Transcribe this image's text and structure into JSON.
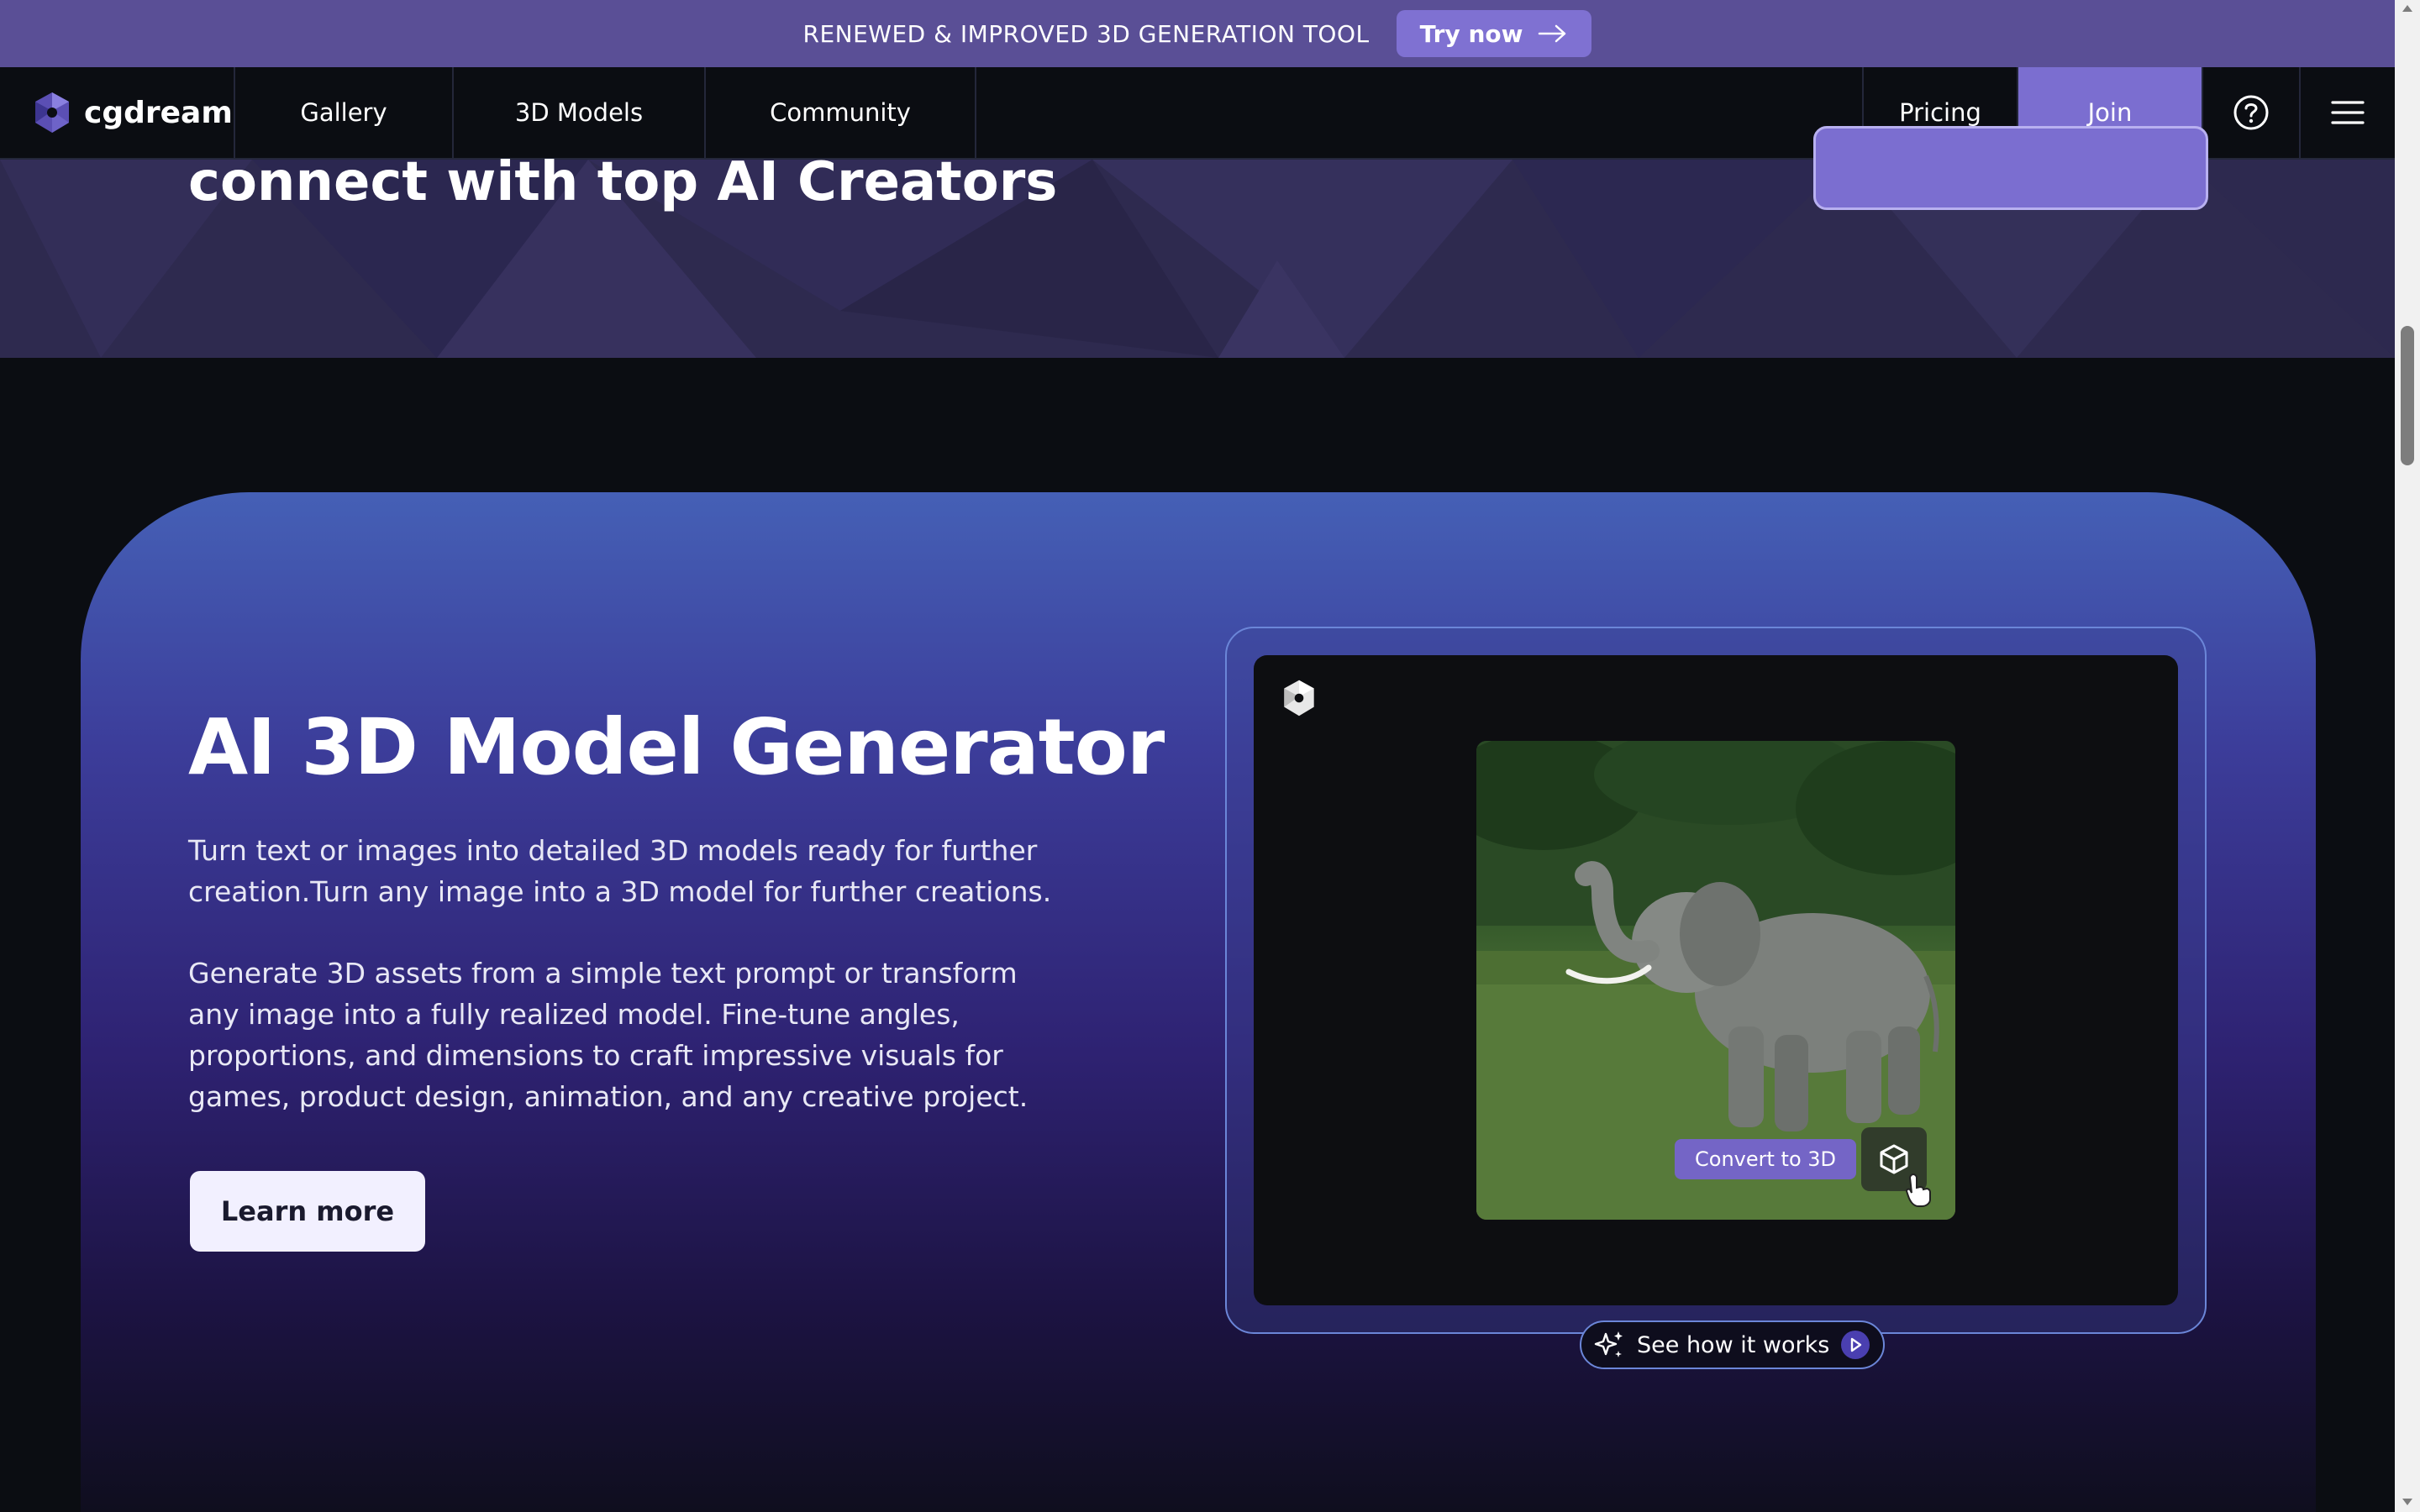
{
  "announcement": {
    "text": "RENEWED & IMPROVED 3D GENERATION TOOL",
    "button_label": "Try now"
  },
  "nav": {
    "logo_text": "cgdream",
    "items": [
      {
        "label": "Gallery"
      },
      {
        "label": "3D Models"
      },
      {
        "label": "Community"
      }
    ],
    "pricing_label": "Pricing",
    "join_label": "Join"
  },
  "hero": {
    "title": "connect with top AI Creators"
  },
  "generator": {
    "title": "AI 3D Model Generator",
    "paragraph1": "Turn text or images into detailed 3D models ready for further creation.Turn any image into a 3D model for further creations.",
    "paragraph2": "Generate 3D assets from a simple text prompt or transform any image into a fully realized model. Fine-tune angles, proportions, and dimensions to craft impressive visuals for games, product design, animation, and any creative project.",
    "learn_more_label": "Learn more"
  },
  "preview": {
    "convert_label": "Convert to 3D",
    "see_how_label": "See how it works"
  },
  "colors": {
    "accent": "#7b6ed0",
    "topbar": "#5a4f96",
    "background": "#0b0d12"
  }
}
